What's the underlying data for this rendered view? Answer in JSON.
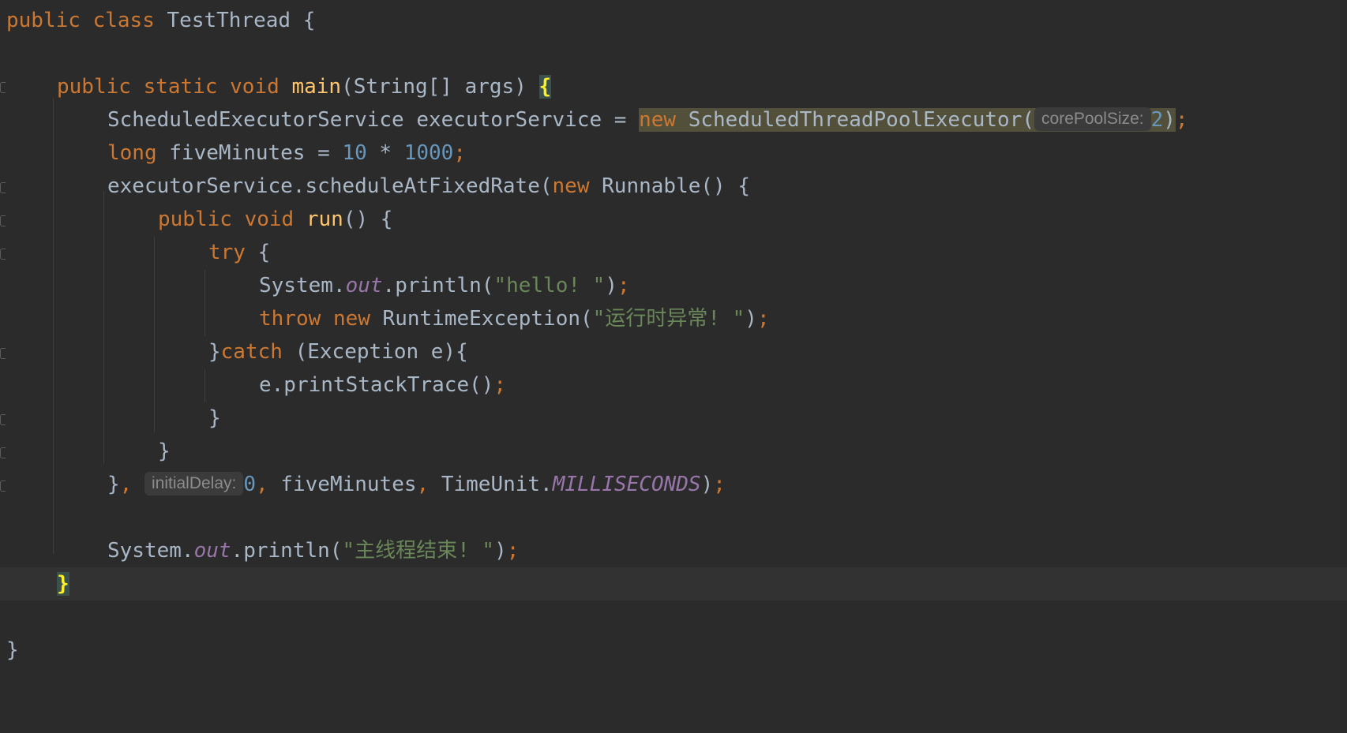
{
  "code": {
    "l1": {
      "t0": "public",
      "t1": " ",
      "t2": "class",
      "t3": " TestThread {"
    },
    "l3": {
      "t0": "public",
      "t1": " ",
      "t2": "static",
      "t3": " ",
      "t4": "void",
      "t5": " ",
      "t6": "main",
      "t7": "(String[] args) ",
      "t8": "{"
    },
    "l4": {
      "t0": "ScheduledExecutorService executorService = ",
      "t1": "new",
      "t2": " ScheduledThreadPoolExecutor(",
      "t3": "corePoolSize:",
      "t4": "2",
      "t5": ")",
      "t6": ";"
    },
    "l5": {
      "t0": "long",
      "t1": " fiveMinutes = ",
      "t2": "10",
      "t3": " * ",
      "t4": "1000",
      "t5": ";"
    },
    "l6": {
      "t0": "executorService.scheduleAtFixedRate(",
      "t1": "new",
      "t2": " Runnable() {"
    },
    "l7": {
      "t0": "public",
      "t1": " ",
      "t2": "void",
      "t3": " ",
      "t4": "run",
      "t5": "() {"
    },
    "l8": {
      "t0": "try",
      "t1": " {"
    },
    "l9": {
      "t0": "System.",
      "t1": "out",
      "t2": ".println(",
      "t3": "\"hello! \"",
      "t4": ")",
      "t5": ";"
    },
    "l10": {
      "t0": "throw",
      "t1": " ",
      "t2": "new",
      "t3": " RuntimeException(",
      "t4": "\"运行时异常! \"",
      "t5": ")",
      "t6": ";"
    },
    "l11": {
      "t0": "}",
      "t1": "catch",
      "t2": " (Exception e){"
    },
    "l12": {
      "t0": "e.printStackTrace()",
      "t1": ";"
    },
    "l13": {
      "t0": "}"
    },
    "l14": {
      "t0": "}"
    },
    "l15": {
      "t0": "}",
      "t1": ", ",
      "t2": "initialDelay:",
      "t3": "0",
      "t4": ", ",
      "t5": "fiveMinutes",
      "t6": ", ",
      "t7": "TimeUnit.",
      "t8": "MILLISECONDS",
      "t9": ")",
      "t10": ";"
    },
    "l17": {
      "t0": "System.",
      "t1": "out",
      "t2": ".println(",
      "t3": "\"主线程结束! \"",
      "t4": ")",
      "t5": ";"
    },
    "l18": {
      "t0": "}"
    },
    "l20": {
      "t0": "}"
    }
  },
  "colors": {
    "background": "#2b2b2b",
    "current_line": "#323232",
    "keyword": "#cc7832",
    "method_declaration": "#ffc66d",
    "number": "#6897bb",
    "string": "#6a8759",
    "static_field": "#9876aa",
    "default_text": "#a9b7c6",
    "matched_brace": "#ffef28",
    "inlay_hint_text": "#8c8c8c",
    "inlay_hint_background": "#3b3b3b"
  }
}
